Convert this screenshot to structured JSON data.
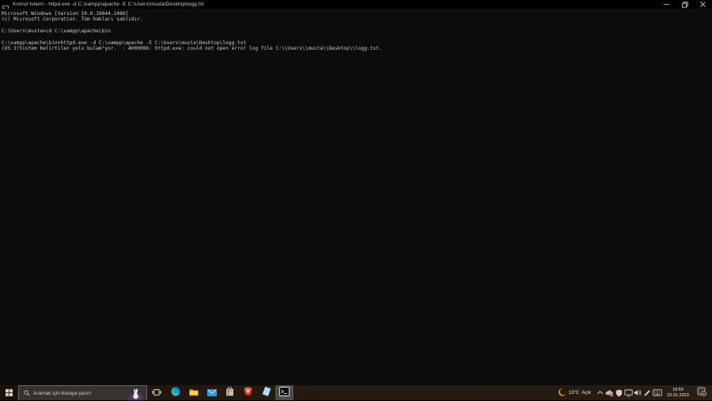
{
  "window": {
    "title": "Komut İstemi - httpd.exe  -d C:\\xampp\\apache -E C:\\Users\\musta\\Desktop\\logg.txt",
    "controls": [
      "minimize",
      "restore",
      "close"
    ]
  },
  "terminal": {
    "lines": [
      "Microsoft Windows [Version 10.0.19044.2486]",
      "(c) Microsoft Corporation. Tüm hakları saklıdır.",
      "",
      "C:\\Users\\musta>cd C:\\xampp\\apache\\bin",
      "",
      "C:\\xampp\\apache\\bin>httpd.exe -d C:\\xampp\\apache -E C:\\Users\\musta\\Desktop\\logg.txt",
      "(OS 3)Sistem belirtilen yolu bulam³yor.  : AH00086: httpd.exe: could not open error log file C:\\\\Users\\\\musta\\\\Desktop\\\\logg.txt."
    ]
  },
  "taskbar": {
    "search": {
      "placeholder": "Aramak için buraya yazın"
    },
    "apps": [
      "edge",
      "file-explorer",
      "mail",
      "microsoft-store",
      "brave",
      "notepad",
      "command-prompt"
    ],
    "active_app": "command-prompt",
    "weather": {
      "temperature": "13°C",
      "condition": "Açık"
    },
    "clock": {
      "time": "18:59",
      "date": "22.01.2023"
    },
    "icons": [
      "start",
      "search",
      "search-highlight-rabbit",
      "task-view",
      "hidden-icons-chevron",
      "onedrive",
      "security-shield",
      "display",
      "volume",
      "pen",
      "touch-keyboard",
      "action-center"
    ]
  },
  "colors": {
    "terminal_bg": "#0c0c0c",
    "terminal_text": "#cccccc",
    "taskbar_bg": "#241910",
    "active_app_bg": "#4d4d4d",
    "moon": "#f0a21d",
    "folder": "#ffd04a",
    "brave_red": "#d63e2a"
  }
}
